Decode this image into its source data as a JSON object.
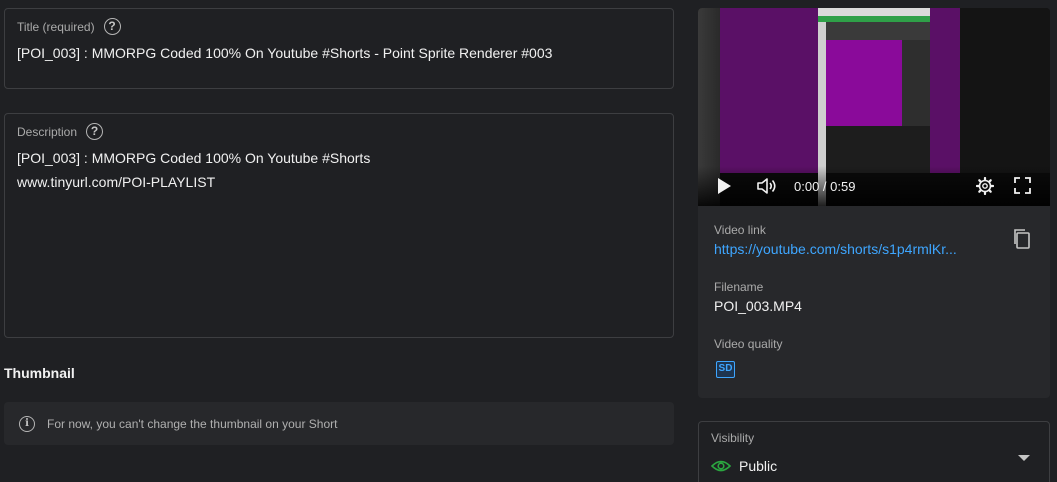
{
  "title_field": {
    "label": "Title (required)",
    "value": "[POI_003] : MMORPG Coded 100% On Youtube #Shorts - Point Sprite Renderer #003"
  },
  "description_field": {
    "label": "Description",
    "lines": [
      "[POI_003] : MMORPG Coded 100% On Youtube #Shorts",
      "www.tinyurl.com/POI-PLAYLIST"
    ]
  },
  "thumbnail": {
    "heading": "Thumbnail",
    "notice": "For now, you can't change the thumbnail on your Short"
  },
  "video_player": {
    "time": "0:00 / 0:59"
  },
  "video_details": {
    "link_label": "Video link",
    "link_value": "https://youtube.com/shorts/s1p4rmlKr...",
    "filename_label": "Filename",
    "filename_value": "POI_003.MP4",
    "quality_label": "Video quality",
    "quality_badge": "SD"
  },
  "visibility": {
    "label": "Visibility",
    "value": "Public",
    "status_color": "#2ba640"
  },
  "icons": {
    "help": "help-circle-icon",
    "info": "info-icon",
    "play": "play-icon",
    "volume": "volume-icon",
    "settings": "gear-icon",
    "fullscreen": "fullscreen-icon",
    "copy": "copy-icon",
    "visibility": "eye-icon",
    "dropdown": "caret-down-icon"
  },
  "colors": {
    "accent_link": "#3ea6ff",
    "background": "#1f2023",
    "card": "#27282b"
  }
}
